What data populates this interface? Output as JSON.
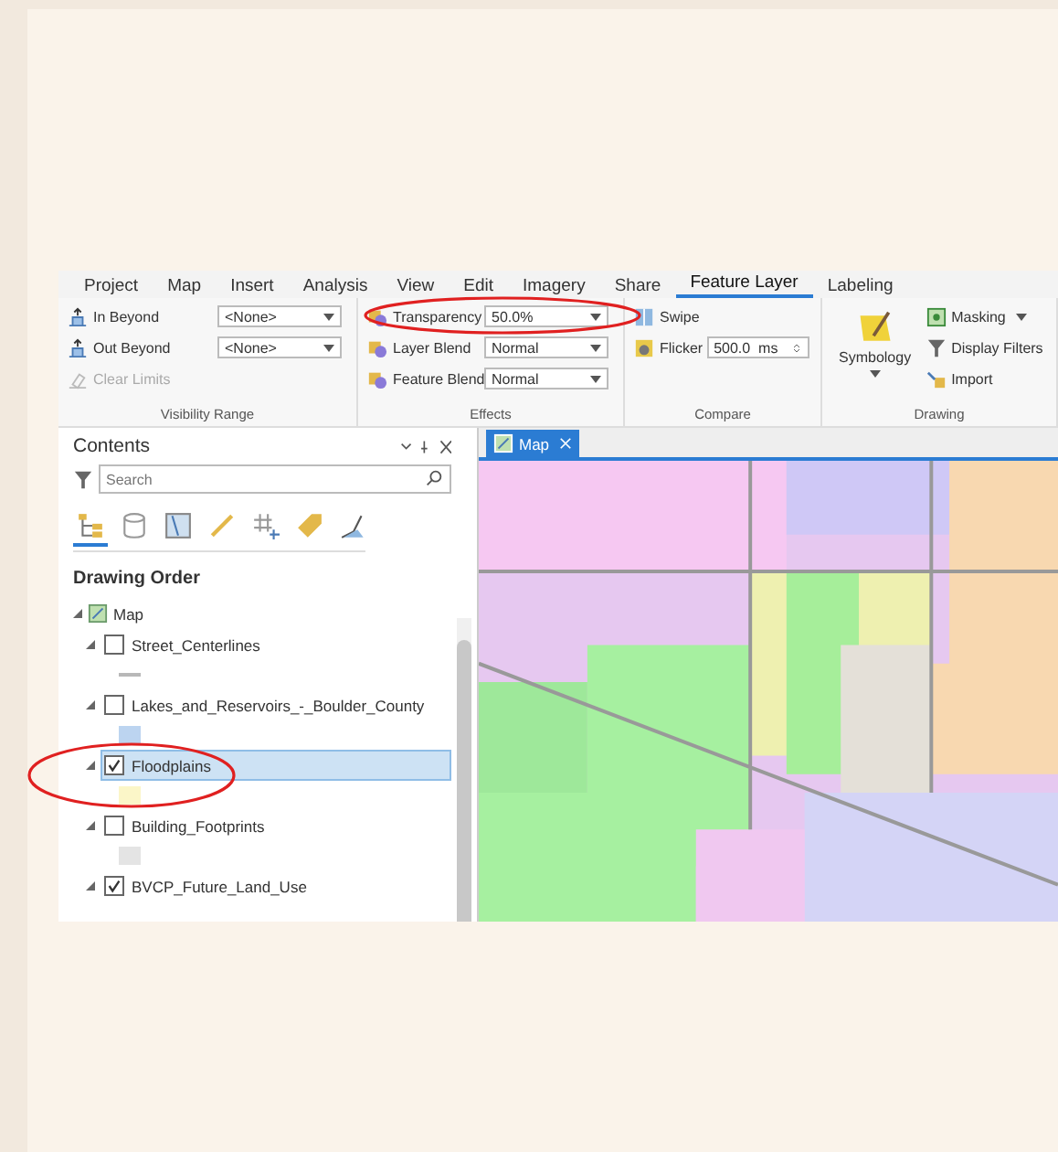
{
  "ribbon": {
    "tabs": [
      {
        "label": "Project",
        "selected": false
      },
      {
        "label": "Map",
        "selected": false
      },
      {
        "label": "Insert",
        "selected": false
      },
      {
        "label": "Analysis",
        "selected": false
      },
      {
        "label": "View",
        "selected": false
      },
      {
        "label": "Edit",
        "selected": false
      },
      {
        "label": "Imagery",
        "selected": false
      },
      {
        "label": "Share",
        "selected": false
      },
      {
        "label": "Feature Layer",
        "selected": true
      },
      {
        "label": "Labeling",
        "selected": false
      }
    ],
    "visibility_range": {
      "label": "Visibility Range",
      "rows": [
        {
          "label": "In Beyond",
          "value": "<None>"
        },
        {
          "label": "Out Beyond",
          "value": "<None>"
        }
      ],
      "clear_limits": {
        "label": "Clear Limits",
        "disabled": true
      }
    },
    "effects": {
      "label": "Effects",
      "rows": [
        {
          "label": "Transparency",
          "value": "50.0%"
        },
        {
          "label": "Layer Blend",
          "value": "Normal"
        },
        {
          "label": "Feature Blend",
          "value": "Normal"
        }
      ]
    },
    "compare": {
      "label": "Compare",
      "swipe": "Swipe",
      "flicker": {
        "label": "Flicker",
        "value": "500.0",
        "unit": "ms"
      }
    },
    "drawing": {
      "label": "Drawing",
      "symbology": "Symbology",
      "masking": "Masking",
      "display_filters": "Display Filters",
      "import": "Import"
    }
  },
  "contents": {
    "title": "Contents",
    "search": {
      "placeholder": "Search"
    },
    "tools": [
      {
        "selected": true
      },
      {
        "selected": false
      },
      {
        "selected": false
      },
      {
        "selected": false
      },
      {
        "selected": false
      },
      {
        "selected": false
      },
      {
        "selected": false
      }
    ],
    "heading": "Drawing Order",
    "map": {
      "label": "Map",
      "expanded": true,
      "children": [
        {
          "label": "Street_Centerlines",
          "checked": false,
          "selected": false,
          "expanded": true,
          "symbol": {
            "kind": "line",
            "color": "#b8b8b8"
          }
        },
        {
          "label": "Lakes_and_Reservoirs_-_Boulder_County",
          "checked": false,
          "selected": false,
          "expanded": true,
          "symbol": {
            "kind": "fill",
            "color": "#bcd4f0"
          }
        },
        {
          "label": "Floodplains",
          "checked": true,
          "selected": true,
          "expanded": true,
          "symbol": {
            "kind": "fill",
            "color": "#fbf6c8"
          }
        },
        {
          "label": "Building_Footprints",
          "checked": false,
          "selected": false,
          "expanded": true,
          "symbol": {
            "kind": "fill",
            "color": "#e4e4e4"
          }
        },
        {
          "label": "BVCP_Future_Land_Use",
          "checked": true,
          "selected": false,
          "expanded": true
        }
      ]
    }
  },
  "map_view": {
    "tab": {
      "label": "Map",
      "selected": true
    }
  }
}
